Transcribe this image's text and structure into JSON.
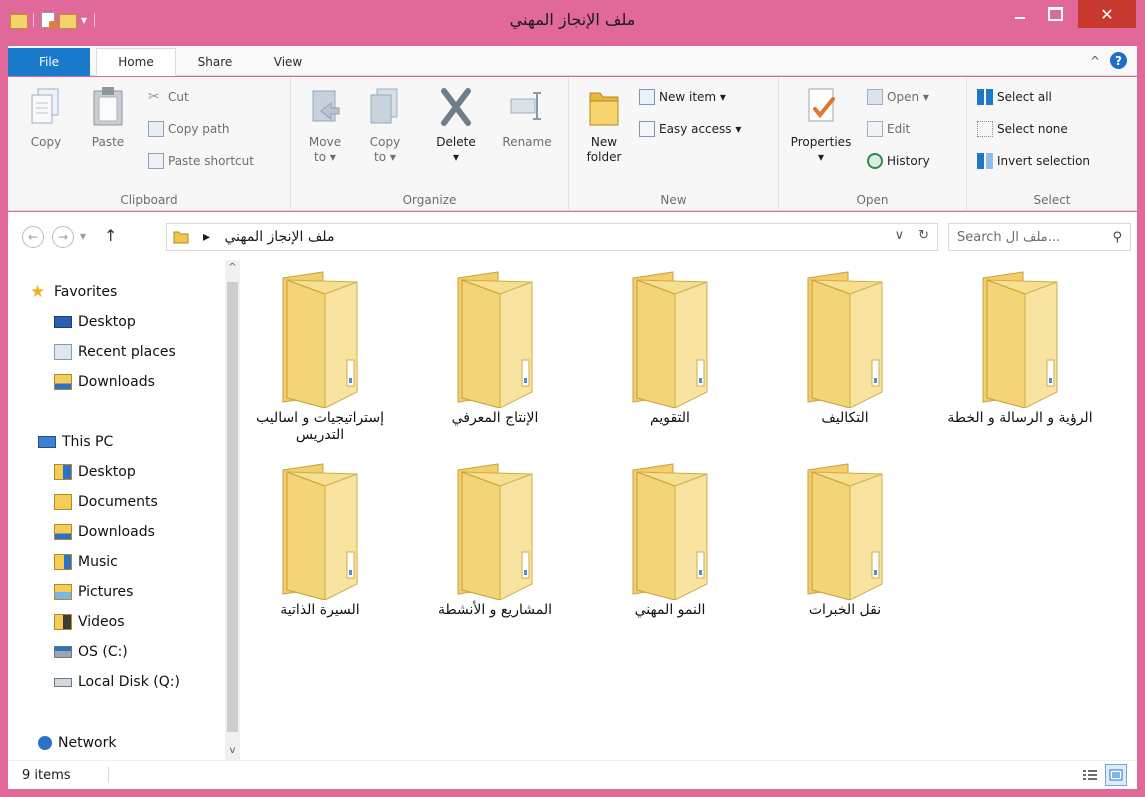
{
  "window": {
    "title": "ملف الإنجاز المهني",
    "qat_icons": [
      "folder-icon",
      "properties-icon",
      "new-folder-icon",
      "customize-arrow-icon"
    ],
    "accent": "#e0699a",
    "close_color": "#c7392f",
    "close_glyph": "✕"
  },
  "tabs": {
    "file": "File",
    "home": "Home",
    "share": "Share",
    "view": "View",
    "active": "Home",
    "collapse_glyph": "^",
    "help_glyph": "?"
  },
  "ribbon": {
    "clipboard": {
      "label": "Clipboard",
      "copy": "Copy",
      "paste": "Paste",
      "cut": "Cut",
      "copy_path": "Copy path",
      "paste_shortcut": "Paste shortcut"
    },
    "organize": {
      "label": "Organize",
      "move_to_1": "Move",
      "move_to_2": "to ▾",
      "copy_to_1": "Copy",
      "copy_to_2": "to ▾",
      "delete": "Delete",
      "delete_arrow": "▾",
      "rename": "Rename"
    },
    "new": {
      "label": "New",
      "new_folder_1": "New",
      "new_folder_2": "folder",
      "new_item": "New item ▾",
      "easy_access": "Easy access ▾"
    },
    "open": {
      "label": "Open",
      "properties": "Properties",
      "properties_arrow": "▾",
      "open": "Open ▾",
      "edit": "Edit",
      "history": "History"
    },
    "select": {
      "label": "Select",
      "select_all": "Select all",
      "select_none": "Select none",
      "invert_selection": "Invert selection"
    }
  },
  "address": {
    "path": "ملف الإنجاز المهني",
    "separator": "▸",
    "dropdown_glyph": "∨",
    "refresh_glyph": "↻",
    "search_placeholder": "Search ملف ال...",
    "search_glyph": "⚲"
  },
  "nav": {
    "back_glyph": "←",
    "forward_glyph": "→",
    "recent_glyph": "▾",
    "up_glyph": "↑",
    "scroll_up": "^",
    "scroll_down": "v"
  },
  "sidebar": {
    "favorites": "Favorites",
    "fav_items": [
      "Desktop",
      "Recent places",
      "Downloads"
    ],
    "this_pc": "This PC",
    "pc_items": [
      "Desktop",
      "Documents",
      "Downloads",
      "Music",
      "Pictures",
      "Videos",
      "OS (C:)",
      "Local Disk (Q:)"
    ],
    "network": "Network"
  },
  "folders": [
    "الرؤية و الرسالة و الخطة",
    "التكاليف",
    "التقويم",
    "الإنتاج المعرفي",
    "إستراتيجيات و اساليب التدريس",
    "نقل الخبرات",
    "النمو المهني",
    "المشاريع و الأنشطة",
    "السيرة الذاتية"
  ],
  "status": {
    "count": "9 items"
  }
}
